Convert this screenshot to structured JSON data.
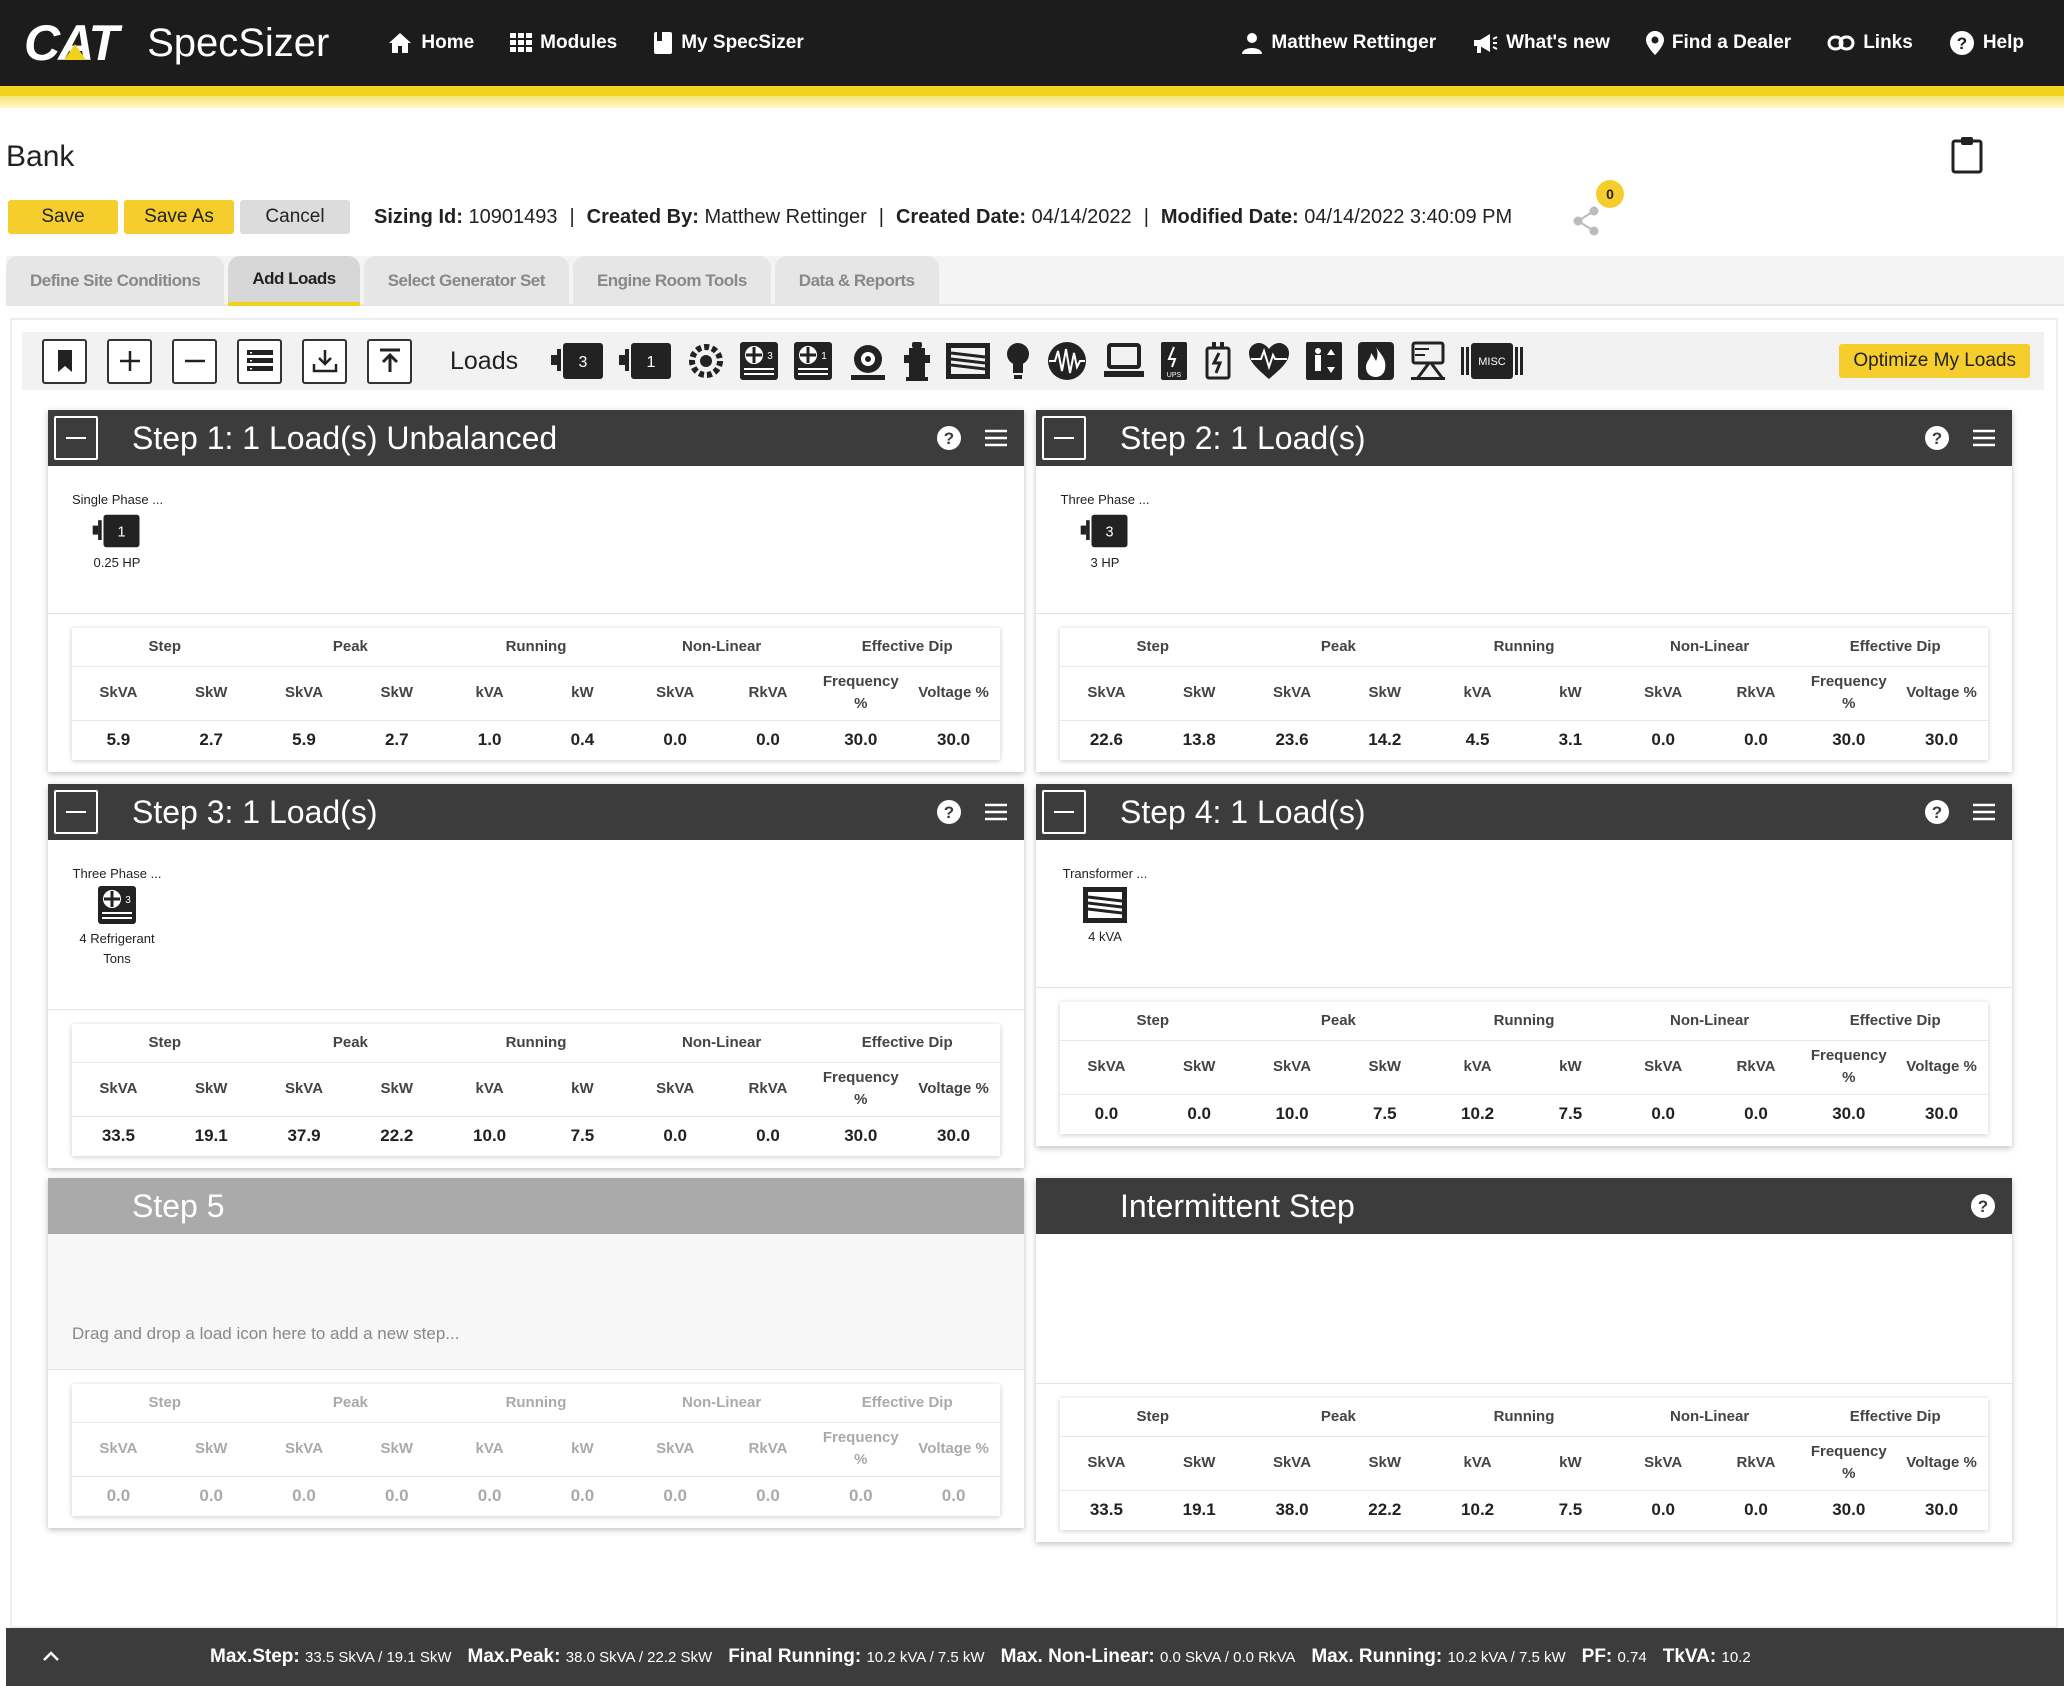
{
  "nav": {
    "logo": "CAT",
    "app": "SpecSizer",
    "left": [
      "Home",
      "Modules",
      "My SpecSizer"
    ],
    "right": [
      "Matthew Rettinger",
      "What's new",
      "Find a Dealer",
      "Links",
      "Help"
    ]
  },
  "page": {
    "title": "Bank",
    "save": "Save",
    "save_as": "Save As",
    "cancel": "Cancel",
    "sizing_label": "Sizing Id:",
    "sizing_id": "10901493",
    "created_by_label": "Created By:",
    "created_by": "Matthew Rettinger",
    "created_date_label": "Created Date:",
    "created_date": "04/14/2022",
    "modified_label": "Modified Date:",
    "modified_date": "04/14/2022 3:40:09 PM",
    "share_count": "0",
    "separator": "|"
  },
  "tabs": [
    "Define Site Conditions",
    "Add Loads",
    "Select Generator Set",
    "Engine Room Tools",
    "Data & Reports"
  ],
  "toolbar": {
    "loads_label": "Loads",
    "optimize": "Optimize My Loads",
    "motor3": "3",
    "motor1": "1",
    "misc": "MISC"
  },
  "table_headers": {
    "groups": [
      "Step",
      "Peak",
      "Running",
      "Non-Linear",
      "Effective Dip"
    ],
    "cols": [
      "SkVA",
      "SkW",
      "SkVA",
      "SkW",
      "kVA",
      "kW",
      "SkVA",
      "RkVA",
      "Frequency %",
      "Voltage %"
    ]
  },
  "steps": [
    {
      "title": "Step 1: 1 Load(s) Unbalanced",
      "load_name": "Single Phase ...",
      "load_icon_text": "1",
      "load_size": "0.25 HP",
      "values": [
        "5.9",
        "2.7",
        "5.9",
        "2.7",
        "1.0",
        "0.4",
        "0.0",
        "0.0",
        "30.0",
        "30.0"
      ]
    },
    {
      "title": "Step 2: 1 Load(s)",
      "load_name": "Three Phase ...",
      "load_icon_text": "3",
      "load_size": "3 HP",
      "values": [
        "22.6",
        "13.8",
        "23.6",
        "14.2",
        "4.5",
        "3.1",
        "0.0",
        "0.0",
        "30.0",
        "30.0"
      ]
    },
    {
      "title": "Step 3: 1 Load(s)",
      "load_name": "Three Phase ...",
      "load_icon_text": "3",
      "load_size": "4 Refrigerant Tons",
      "values": [
        "33.5",
        "19.1",
        "37.9",
        "22.2",
        "10.0",
        "7.5",
        "0.0",
        "0.0",
        "30.0",
        "30.0"
      ]
    },
    {
      "title": "Step 4: 1 Load(s)",
      "load_name": "Transformer ...",
      "load_size": "4 kVA",
      "values": [
        "0.0",
        "0.0",
        "10.0",
        "7.5",
        "10.2",
        "7.5",
        "0.0",
        "0.0",
        "30.0",
        "30.0"
      ]
    },
    {
      "title": "Step 5",
      "placeholder": "Drag and drop a load icon here to add a new step...",
      "values": [
        "0.0",
        "0.0",
        "0.0",
        "0.0",
        "0.0",
        "0.0",
        "0.0",
        "0.0",
        "0.0",
        "0.0"
      ]
    },
    {
      "title": "Intermittent Step",
      "values": [
        "33.5",
        "19.1",
        "38.0",
        "22.2",
        "10.2",
        "7.5",
        "0.0",
        "0.0",
        "30.0",
        "30.0"
      ]
    }
  ],
  "footer": [
    {
      "label": "Max.Step:",
      "value": "33.5 SkVA / 19.1 SkW"
    },
    {
      "label": "Max.Peak:",
      "value": "38.0 SkVA / 22.2 SkW"
    },
    {
      "label": "Final Running:",
      "value": "10.2 kVA / 7.5 kW"
    },
    {
      "label": "Max. Non-Linear:",
      "value": "0.0 SkVA / 0.0 RkVA"
    },
    {
      "label": "Max. Running:",
      "value": "10.2 kVA / 7.5 kW"
    },
    {
      "label": "PF:",
      "value": "0.74"
    },
    {
      "label": "TkVA:",
      "value": "10.2"
    }
  ],
  "colors": {
    "accent": "#f2d21c",
    "header": "#3c3c3c",
    "nav": "#1c1c1c"
  }
}
